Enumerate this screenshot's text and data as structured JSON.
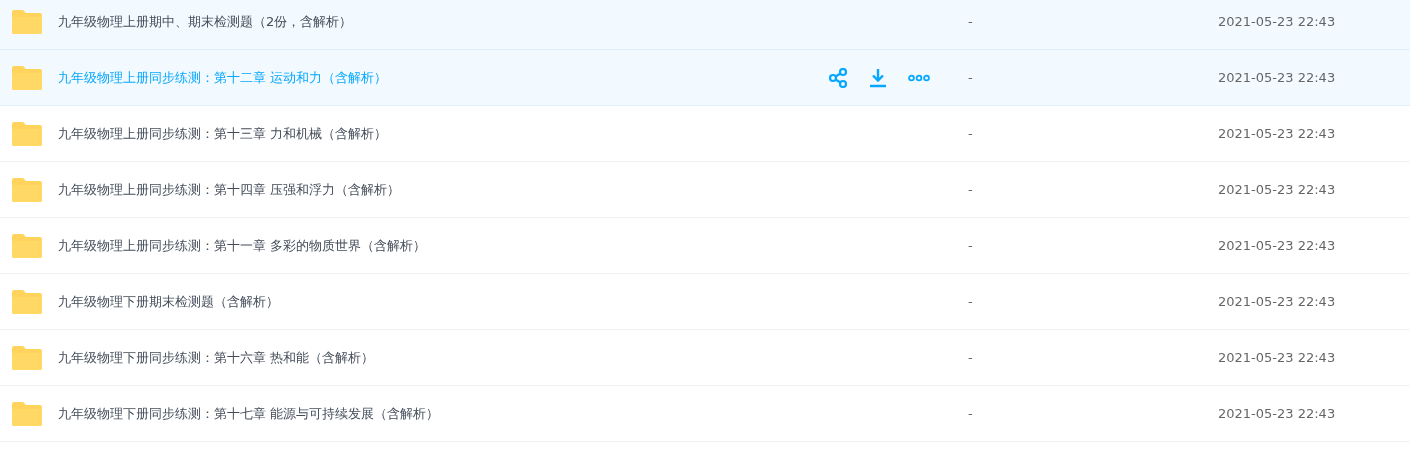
{
  "files": [
    {
      "name": "九年级物理上册期中、期末检测题（2份，含解析）",
      "size": "-",
      "modified": "2021-05-23 22:43",
      "highlighted": true,
      "hovered": false
    },
    {
      "name": "九年级物理上册同步练测：第十二章 运动和力（含解析）",
      "size": "-",
      "modified": "2021-05-23 22:43",
      "highlighted": true,
      "hovered": true
    },
    {
      "name": "九年级物理上册同步练测：第十三章 力和机械（含解析）",
      "size": "-",
      "modified": "2021-05-23 22:43",
      "highlighted": false,
      "hovered": false
    },
    {
      "name": "九年级物理上册同步练测：第十四章 压强和浮力（含解析）",
      "size": "-",
      "modified": "2021-05-23 22:43",
      "highlighted": false,
      "hovered": false
    },
    {
      "name": "九年级物理上册同步练测：第十一章 多彩的物质世界（含解析）",
      "size": "-",
      "modified": "2021-05-23 22:43",
      "highlighted": false,
      "hovered": false
    },
    {
      "name": "九年级物理下册期末检测题（含解析）",
      "size": "-",
      "modified": "2021-05-23 22:43",
      "highlighted": false,
      "hovered": false
    },
    {
      "name": "九年级物理下册同步练测：第十六章 热和能（含解析）",
      "size": "-",
      "modified": "2021-05-23 22:43",
      "highlighted": false,
      "hovered": false
    },
    {
      "name": "九年级物理下册同步练测：第十七章 能源与可持续发展（含解析）",
      "size": "-",
      "modified": "2021-05-23 22:43",
      "highlighted": false,
      "hovered": false
    }
  ]
}
